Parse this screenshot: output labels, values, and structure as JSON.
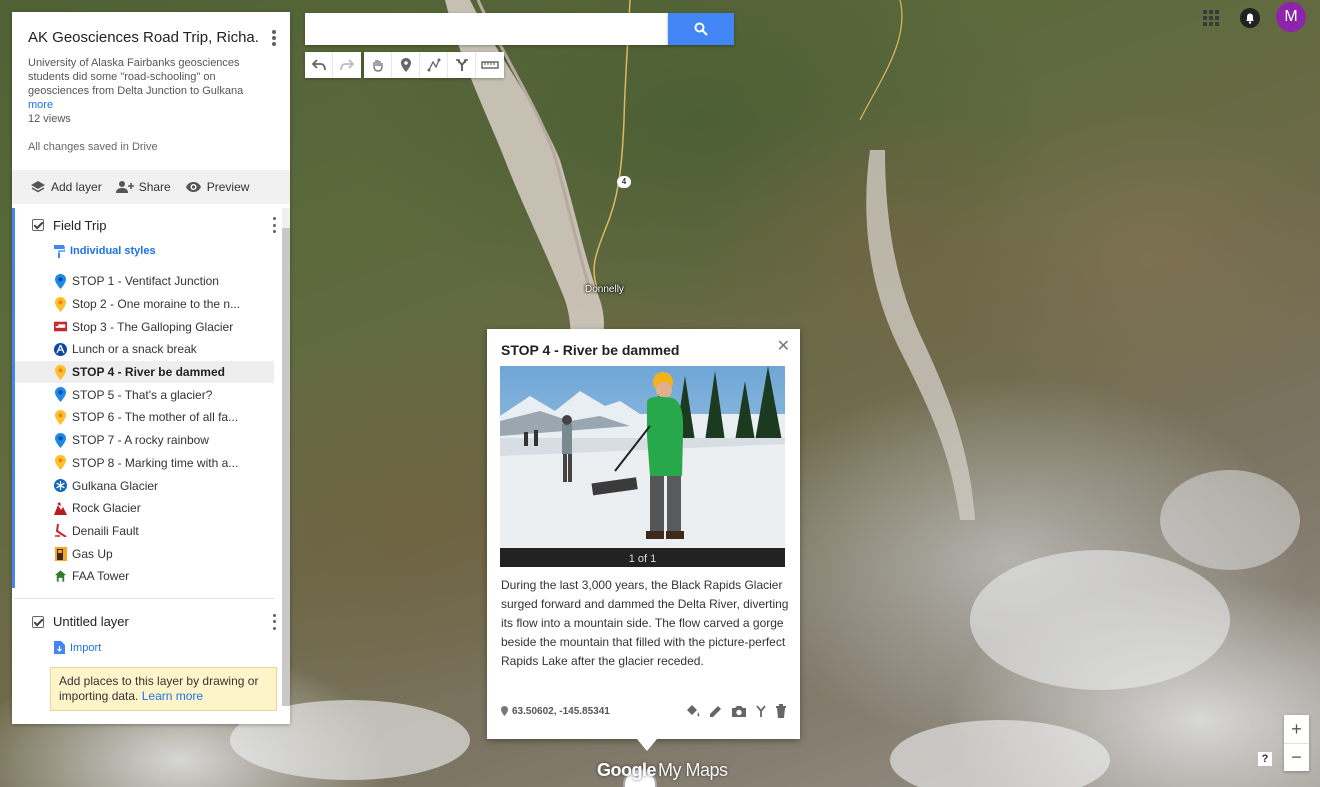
{
  "map": {
    "place_label": "Donnelly",
    "route_shield": "4"
  },
  "panel": {
    "title": "AK Geosciences Road Trip, Richa...",
    "description": "University of Alaska Fairbanks geosciences students did some \"road-schooling\" on geosciences from Delta Junction to Gulkana",
    "more_label": "more",
    "views": "12 views",
    "saved_status": "All changes saved in Drive",
    "toolbar": {
      "add_layer": "Add layer",
      "share": "Share",
      "preview": "Preview"
    },
    "layers": [
      {
        "name": "Field Trip",
        "style_link": "Individual styles",
        "items": [
          {
            "label": "STOP 1 - Ventifact Junction",
            "icon": "pin-blue-icon"
          },
          {
            "label": "Stop 2 - One moraine to the n...",
            "icon": "pin-yellow-icon"
          },
          {
            "label": "Stop 3 - The Galloping Glacier",
            "icon": "bed-icon"
          },
          {
            "label": "Lunch or a snack break",
            "icon": "picnic-icon"
          },
          {
            "label": "STOP 4 - River be dammed",
            "icon": "pin-yellow-icon"
          },
          {
            "label": "STOP 5 - That's a glacier?",
            "icon": "pin-blue-icon"
          },
          {
            "label": "STOP 6 - The mother of all fa...",
            "icon": "pin-yellow-icon"
          },
          {
            "label": "STOP 7 - A rocky rainbow",
            "icon": "pin-blue-icon"
          },
          {
            "label": "STOP 8 - Marking time with a...",
            "icon": "pin-yellow-icon"
          },
          {
            "label": "Gulkana Glacier",
            "icon": "snowflake-icon"
          },
          {
            "label": "Rock Glacier",
            "icon": "mountain-icon"
          },
          {
            "label": "Denaili Fault",
            "icon": "fault-icon"
          },
          {
            "label": "Gas Up",
            "icon": "gas-station-icon"
          },
          {
            "label": "FAA Tower",
            "icon": "tower-icon"
          }
        ]
      },
      {
        "name": "Untitled layer",
        "import_label": "Import",
        "tip_text": "Add places to this layer by drawing or importing data.",
        "tip_link": "Learn more"
      }
    ]
  },
  "search": {
    "value": "",
    "placeholder": ""
  },
  "user": {
    "initial": "M"
  },
  "popup": {
    "title": "STOP 4 - River be dammed",
    "photo_count": "1 of 1",
    "description": "During the last 3,000 years, the Black Rapids Glacier surged forward and dammed the Delta River, diverting its flow into a mountain side. The flow carved a gorge beside the mountain that filled with the picture-perfect Rapids Lake after the glacier receded.",
    "coordinates": "63.50602, -145.85341"
  },
  "footer": {
    "brand_google": "Google",
    "brand_mymaps": "My Maps",
    "help": "?"
  },
  "colors": {
    "accent": "#4285f4",
    "avatar": "#8e24aa",
    "tip_bg": "#fdf5c9"
  }
}
